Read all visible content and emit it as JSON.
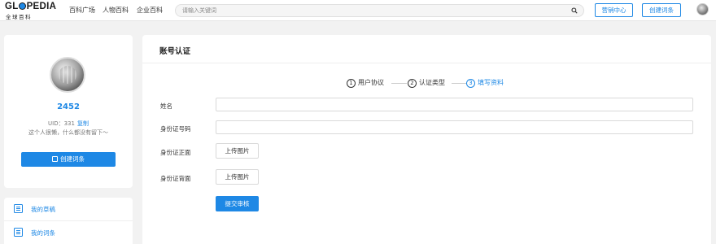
{
  "header": {
    "logo_text": "GL PEDIA",
    "logo_sub": "全球百科",
    "nav": [
      "百科广场",
      "人物百科",
      "企业百科"
    ],
    "search_placeholder": "请输入关键词",
    "marketing_button": "营销中心",
    "create_entry_button": "创建词条",
    "icons": {
      "search": "search-icon",
      "avatar": "user-avatar"
    }
  },
  "profile": {
    "username": "2452",
    "uid_label": "UID：331",
    "copy_label": "复制",
    "bio": "这个人很懒，什么都没有留下～",
    "create_button": "创建词条"
  },
  "menu": {
    "items": [
      {
        "label": "我的草稿",
        "icon": "draft-icon"
      },
      {
        "label": "我的词条",
        "icon": "entries-icon"
      }
    ]
  },
  "main": {
    "title": "账号认证",
    "steps": [
      {
        "num": "1",
        "label": "用户协议",
        "active": false
      },
      {
        "num": "2",
        "label": "认证类型",
        "active": false
      },
      {
        "num": "3",
        "label": "填写资料",
        "active": true
      }
    ],
    "fields": {
      "name_label": "姓名",
      "name_value": "",
      "id_label": "身份证号码",
      "id_value": "",
      "id_front_label": "身份证正面",
      "id_back_label": "身份证背面",
      "upload_label": "上传图片",
      "submit_label": "提交审核"
    }
  },
  "colors": {
    "accent": "#1e88e5",
    "background": "#f2f2f2"
  }
}
